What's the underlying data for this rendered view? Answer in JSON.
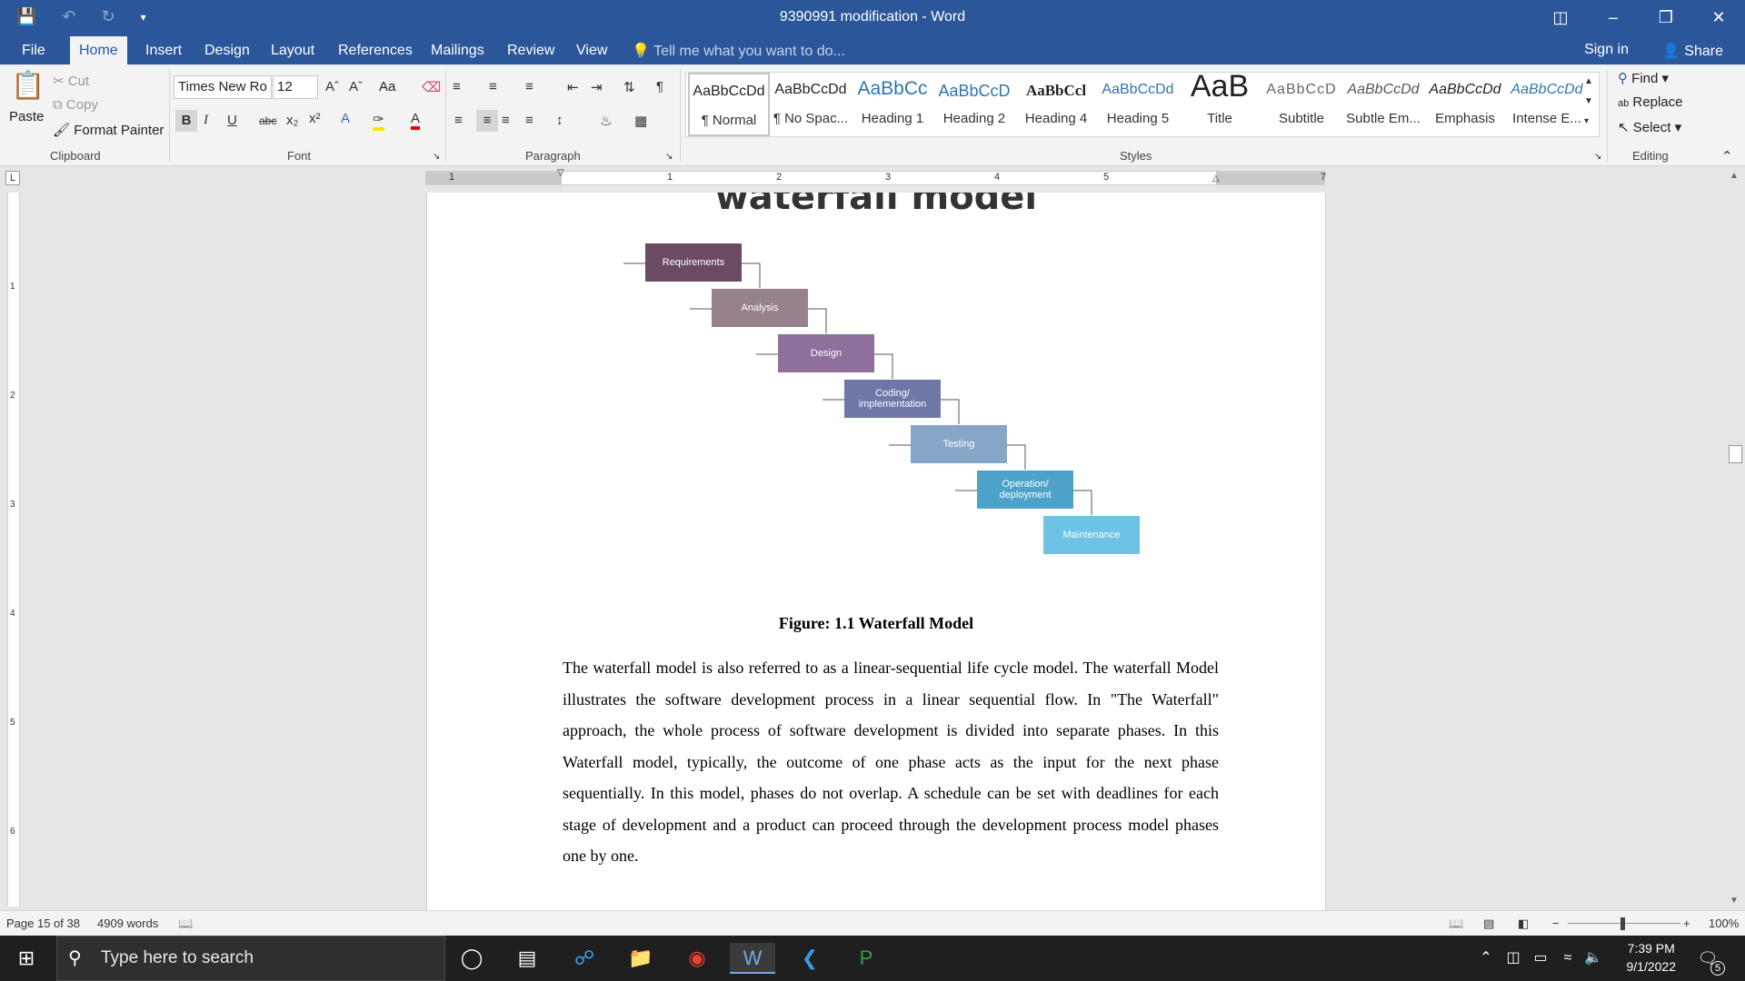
{
  "window": {
    "title": "9390991 modification - Word",
    "controls": [
      "ribbon-display-icon",
      "minimize-icon",
      "restore-icon",
      "close-icon"
    ]
  },
  "quick_access": [
    "save-icon",
    "undo-icon",
    "redo-icon",
    "customize-icon"
  ],
  "menu": {
    "tabs": [
      "File",
      "Home",
      "Insert",
      "Design",
      "Layout",
      "References",
      "Mailings",
      "Review",
      "View"
    ],
    "active_tab": "Home",
    "tell_me": "Tell me what you want to do...",
    "sign_in": "Sign in",
    "share": "Share"
  },
  "ribbon": {
    "clipboard": {
      "label": "Clipboard",
      "paste": "Paste",
      "cut": "Cut",
      "copy": "Copy",
      "format_painter": "Format Painter"
    },
    "font": {
      "label": "Font",
      "font_name": "Times New Ro",
      "font_size": "12",
      "change_case": "Aa"
    },
    "paragraph": {
      "label": "Paragraph"
    },
    "styles": {
      "label": "Styles",
      "items": [
        {
          "preview": "AaBbCcDd",
          "name": "¶ Normal"
        },
        {
          "preview": "AaBbCcDd",
          "name": "¶ No Spac..."
        },
        {
          "preview": "AaBbCc",
          "name": "Heading 1"
        },
        {
          "preview": "AaBbCcD",
          "name": "Heading 2"
        },
        {
          "preview": "AaBbCcl",
          "name": "Heading 4"
        },
        {
          "preview": "AaBbCcDd",
          "name": "Heading 5"
        },
        {
          "preview": "AaB",
          "name": "Title"
        },
        {
          "preview": "AaBbCcD",
          "name": "Subtitle"
        },
        {
          "preview": "AaBbCcDd",
          "name": "Subtle Em..."
        },
        {
          "preview": "AaBbCcDd",
          "name": "Emphasis"
        },
        {
          "preview": "AaBbCcDd",
          "name": "Intense E..."
        }
      ]
    },
    "editing": {
      "label": "Editing",
      "find": "Find",
      "replace": "Replace",
      "select": "Select"
    }
  },
  "ruler": {
    "h_numbers": [
      "1",
      "1",
      "2",
      "3",
      "4",
      "5",
      "7"
    ],
    "v_numbers": [
      "1",
      "2",
      "3",
      "4",
      "5",
      "6"
    ]
  },
  "document": {
    "heading": "waterfall model",
    "diagram": {
      "phases": [
        {
          "label": "Requirements",
          "color": "#6b4a63"
        },
        {
          "label": "Analysis",
          "color": "#97818f"
        },
        {
          "label": "Design",
          "color": "#8f6f9c"
        },
        {
          "label": "Coding/ implementation",
          "color": "#6e77a6"
        },
        {
          "label": "Testing",
          "color": "#86a6c8"
        },
        {
          "label": "Operation/ deployment",
          "color": "#4da2c9"
        },
        {
          "label": "Maintenance",
          "color": "#6cc3e3"
        }
      ]
    },
    "caption": "Figure: 1.1 Waterfall Model",
    "paragraph": "The waterfall model is also referred to as a linear-sequential life cycle model. The waterfall Model illustrates the software development process in a linear sequential flow. In \"The Waterfall\" approach, the whole process of software development is divided into separate phases. In this Waterfall model, typically, the outcome of one phase acts as the input for the next phase sequentially.  In this model, phases do not overlap. A schedule can be set with deadlines for each stage of development and a product can proceed through the development process model phases one by one."
  },
  "status": {
    "page": "Page 15 of 38",
    "words": "4909 words",
    "zoom": "100%"
  },
  "taskbar": {
    "search_placeholder": "Type here to search",
    "time": "7:39 PM",
    "date": "9/1/2022",
    "notifications": "5"
  }
}
